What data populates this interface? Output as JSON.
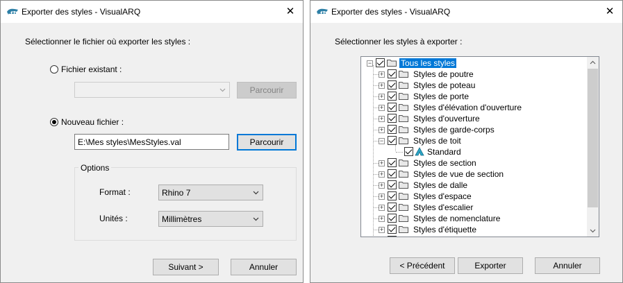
{
  "accent": "#0078d7",
  "dialog1": {
    "title": "Exporter des styles - VisualARQ",
    "close_glyph": "✕",
    "instruction": "Sélectionner le fichier où exporter les styles :",
    "existing_file_label": "Fichier existant :",
    "existing_browse_label": "Parcourir",
    "new_file_label": "Nouveau fichier :",
    "new_file_value": "E:\\Mes styles\\MesStyles.val",
    "new_browse_label": "Parcourir",
    "options": {
      "title": "Options",
      "format_label": "Format :",
      "format_value": "Rhino 7",
      "units_label": "Unités :",
      "units_value": "Millimètres"
    },
    "next_label": "Suivant >",
    "cancel_label": "Annuler"
  },
  "dialog2": {
    "title": "Exporter des styles - VisualARQ",
    "close_glyph": "✕",
    "instruction": "Sélectionner les styles à exporter :",
    "tree": {
      "root": "Tous les styles",
      "items": [
        "Styles de poutre",
        "Styles de poteau",
        "Styles de porte",
        "Styles d'élévation d'ouverture",
        "Styles d'ouverture",
        "Styles de garde-corps",
        "Styles de toit",
        "Standard",
        "Styles de section",
        "Styles de vue de section",
        "Styles de dalle",
        "Styles d'espace",
        "Styles d'escalier",
        "Styles de nomenclature",
        "Styles d'étiquette"
      ]
    },
    "back_label": "< Précédent",
    "export_label": "Exporter",
    "cancel_label": "Annuler"
  }
}
